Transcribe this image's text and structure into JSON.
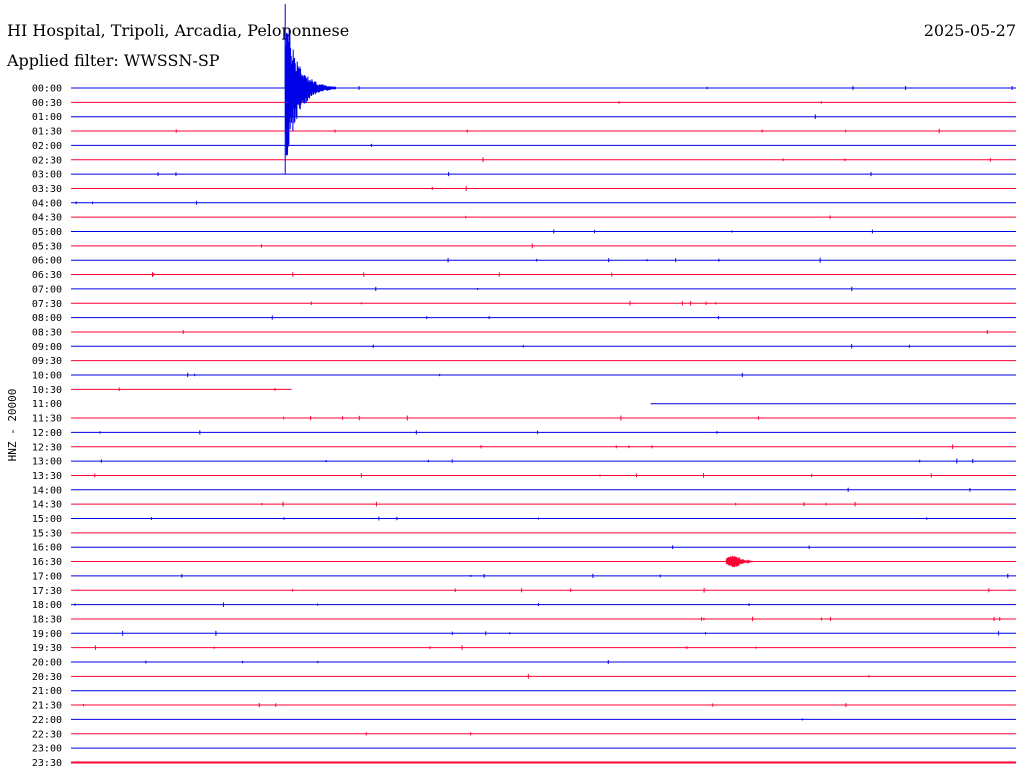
{
  "header": {
    "station": "HI Hospital, Tripoli, Arcadia, Peloponnese",
    "date": "2025-05-27",
    "filter": "Applied filter: WWSSN-SP"
  },
  "colors": {
    "line_a": "#0000e6",
    "line_b": "#ff0033"
  },
  "chart_data": {
    "type": "line",
    "subtype": "helicorder",
    "ylabel": "HNZ - 20000",
    "row_interval_minutes": 30,
    "row_labels": [
      "00:00",
      "00:30",
      "01:00",
      "01:30",
      "02:00",
      "02:30",
      "03:00",
      "03:30",
      "04:00",
      "04:30",
      "05:00",
      "05:30",
      "06:00",
      "06:30",
      "07:00",
      "07:30",
      "08:00",
      "08:30",
      "09:00",
      "09:30",
      "10:00",
      "10:30",
      "11:00",
      "11:30",
      "12:00",
      "12:30",
      "13:00",
      "13:30",
      "14:00",
      "14:30",
      "15:00",
      "15:30",
      "16:00",
      "16:30",
      "17:00",
      "17:30",
      "18:00",
      "18:30",
      "19:00",
      "19:30",
      "20:00",
      "20:30",
      "21:00",
      "21:30",
      "22:00",
      "22:30",
      "23:00",
      "23:30"
    ],
    "row_colors": "alternating blue / red",
    "gaps": [
      {
        "row": "10:30",
        "trace_from_min": 0,
        "trace_to_min": 7
      },
      {
        "row": "11:00",
        "trace_from_min": 18.4,
        "trace_to_min": 30
      }
    ],
    "events": [
      {
        "row": "00:00",
        "onset_min": 6.8,
        "duration_min": 1.6,
        "amplitude": "very large (spans ~6 rows)"
      },
      {
        "row": "16:30",
        "onset_min": 20.8,
        "duration_min": 0.9,
        "amplitude": "small"
      }
    ],
    "grid": false
  }
}
